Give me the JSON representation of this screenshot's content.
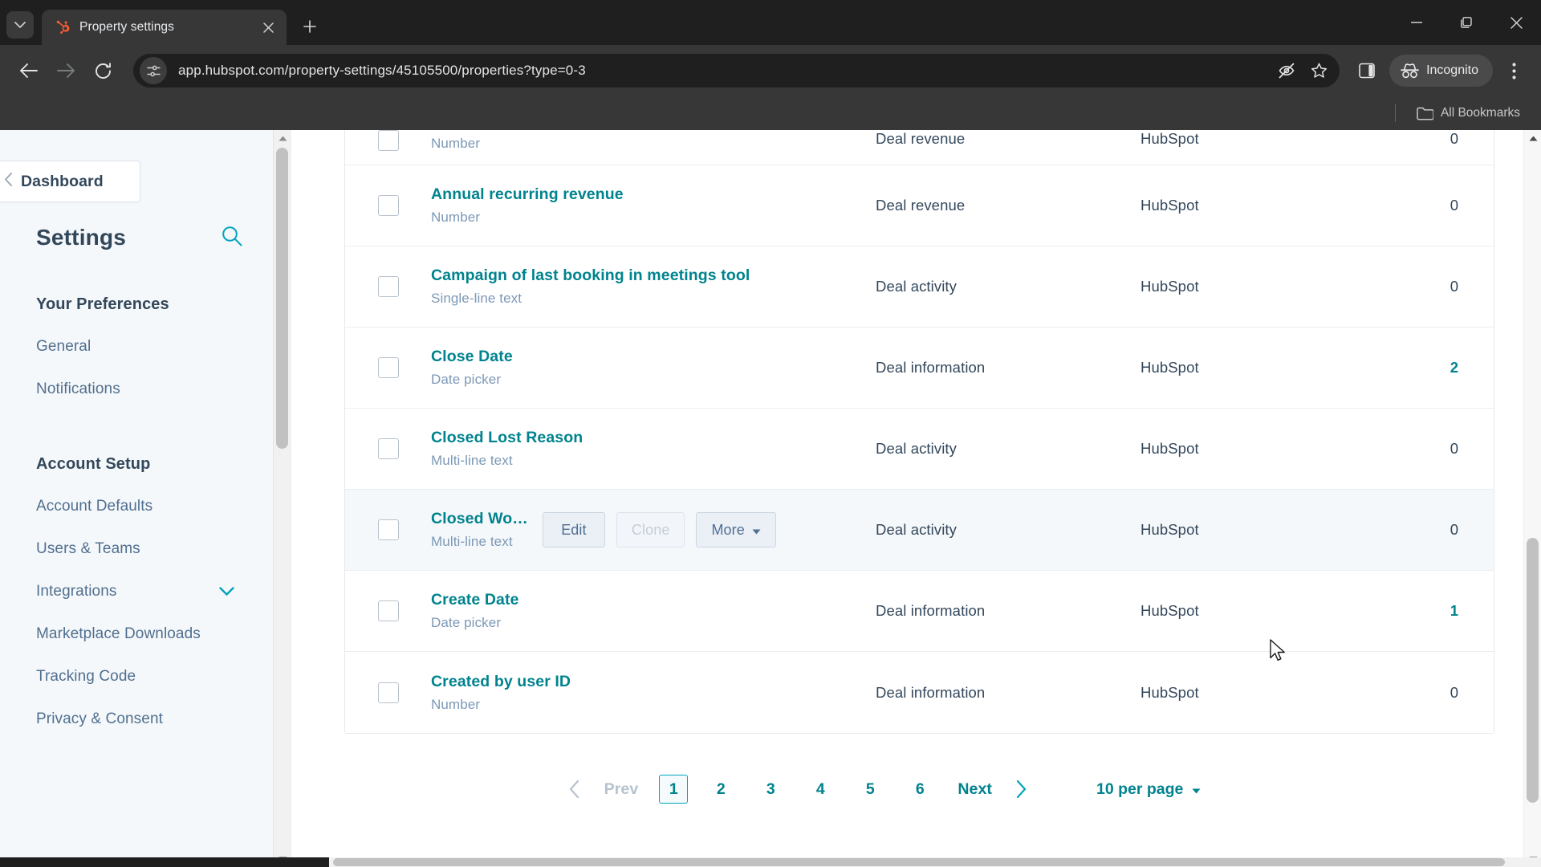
{
  "browser": {
    "tab": {
      "title": "Property settings",
      "favicon_name": "hubspot-sprocket-icon",
      "close_label": "×"
    },
    "new_tab_label": "+",
    "window_controls": {
      "minimize": "–",
      "maximize": "❐",
      "close": "✕"
    },
    "omnibox": {
      "url": "app.hubspot.com/property-settings/45105500/properties?type=0-3",
      "site_info_icon": "site-settings-icon",
      "tracking_protection_icon": "eye-off-icon",
      "bookmark_icon": "star-icon"
    },
    "side_panel_icon": "side-panel-icon",
    "incognito_label": "Incognito",
    "menu_icon": "three-dot-menu-icon",
    "bookmarks": {
      "all_bookmarks_label": "All Bookmarks",
      "folder_icon": "folder-icon"
    }
  },
  "sidebar": {
    "back_button": "Dashboard",
    "title": "Settings",
    "search_icon": "search-icon",
    "sections": [
      {
        "heading": "Your Preferences",
        "items": [
          {
            "label": "General",
            "caret": false
          },
          {
            "label": "Notifications",
            "caret": false
          }
        ]
      },
      {
        "heading": "Account Setup",
        "items": [
          {
            "label": "Account Defaults",
            "caret": false
          },
          {
            "label": "Users & Teams",
            "caret": false
          },
          {
            "label": "Integrations",
            "caret": true
          },
          {
            "label": "Marketplace Downloads",
            "caret": false
          },
          {
            "label": "Tracking Code",
            "caret": false
          },
          {
            "label": "Privacy & Consent",
            "caret": false
          }
        ]
      }
    ]
  },
  "table": {
    "rows": [
      {
        "name": "",
        "type": "Number",
        "group": "Deal revenue",
        "source": "HubSpot",
        "used_in": "0",
        "used_linked": false,
        "partial": true,
        "hovered": false
      },
      {
        "name": "Annual recurring revenue",
        "type": "Number",
        "group": "Deal revenue",
        "source": "HubSpot",
        "used_in": "0",
        "used_linked": false,
        "partial": false,
        "hovered": false
      },
      {
        "name": "Campaign of last booking in meetings tool",
        "type": "Single-line text",
        "group": "Deal activity",
        "source": "HubSpot",
        "used_in": "0",
        "used_linked": false,
        "partial": false,
        "hovered": false
      },
      {
        "name": "Close Date",
        "type": "Date picker",
        "group": "Deal information",
        "source": "HubSpot",
        "used_in": "2",
        "used_linked": true,
        "partial": false,
        "hovered": false
      },
      {
        "name": "Closed Lost Reason",
        "type": "Multi-line text",
        "group": "Deal activity",
        "source": "HubSpot",
        "used_in": "0",
        "used_linked": false,
        "partial": false,
        "hovered": false
      },
      {
        "name": "Closed Wo…",
        "type": "Multi-line text",
        "group": "Deal activity",
        "source": "HubSpot",
        "used_in": "0",
        "used_linked": false,
        "partial": false,
        "hovered": true
      },
      {
        "name": "Create Date",
        "type": "Date picker",
        "group": "Deal information",
        "source": "HubSpot",
        "used_in": "1",
        "used_linked": true,
        "partial": false,
        "hovered": false
      },
      {
        "name": "Created by user ID",
        "type": "Number",
        "group": "Deal information",
        "source": "HubSpot",
        "used_in": "0",
        "used_linked": false,
        "partial": false,
        "hovered": false
      }
    ],
    "row_actions": {
      "edit": "Edit",
      "clone": "Clone",
      "more": "More"
    }
  },
  "pagination": {
    "prev": "Prev",
    "next": "Next",
    "pages": [
      "1",
      "2",
      "3",
      "4",
      "5",
      "6"
    ],
    "active_page": "1",
    "per_page": "10 per page"
  },
  "colors": {
    "link": "#00838e",
    "accent": "#00a4bd",
    "text": "#33475b",
    "muted": "#7c98b6",
    "sidebar_bg": "#f5f8fa"
  }
}
